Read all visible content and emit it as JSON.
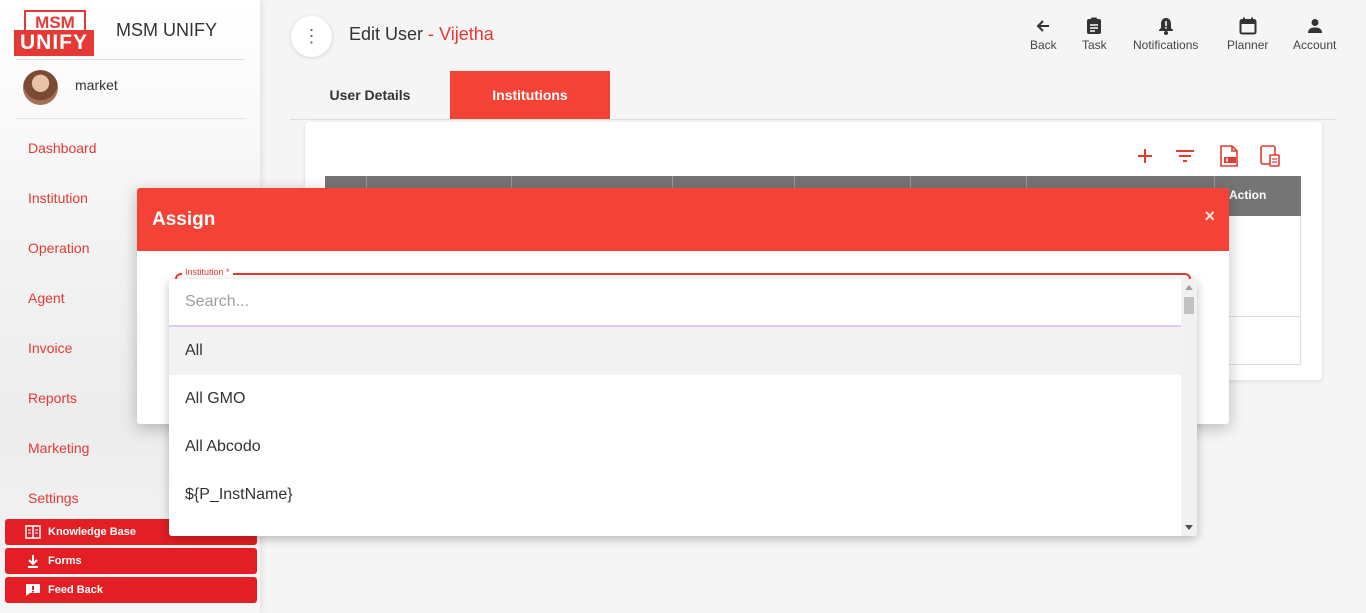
{
  "app": {
    "logo_top": "MSM",
    "logo_bottom": "UNIFY",
    "title": "MSM UNIFY"
  },
  "user": {
    "name": "market"
  },
  "sidebar": {
    "items": [
      {
        "label": "Dashboard"
      },
      {
        "label": "Institution"
      },
      {
        "label": "Operation"
      },
      {
        "label": "Agent"
      },
      {
        "label": "Invoice"
      },
      {
        "label": "Reports"
      },
      {
        "label": "Marketing"
      },
      {
        "label": "Settings"
      }
    ],
    "buttons": [
      {
        "label": "Knowledge Base",
        "icon": "book-icon"
      },
      {
        "label": "Forms",
        "icon": "download-icon"
      },
      {
        "label": "Feed Back",
        "icon": "feedback-icon"
      }
    ]
  },
  "header": {
    "title": "Edit User",
    "separator": " - ",
    "subtitle": "Vijetha",
    "actions": [
      {
        "label": "Back",
        "icon": "arrow-left-icon"
      },
      {
        "label": "Task",
        "icon": "clipboard-icon"
      },
      {
        "label": "Notifications",
        "icon": "bell-icon"
      },
      {
        "label": "Planner",
        "icon": "calendar-icon"
      },
      {
        "label": "Account",
        "icon": "person-icon"
      }
    ]
  },
  "tabs": [
    {
      "label": "User Details",
      "active": false
    },
    {
      "label": "Institutions",
      "active": true
    }
  ],
  "table": {
    "action_header": "Action"
  },
  "modal": {
    "title": "Assign",
    "close": "×",
    "field_label": "Institution *"
  },
  "dropdown": {
    "search_placeholder": "Search...",
    "options": [
      {
        "label": "All",
        "highlighted": true
      },
      {
        "label": "All GMO"
      },
      {
        "label": "All Abcodo"
      },
      {
        "label": "${P_InstName}"
      }
    ]
  },
  "colors": {
    "accent": "#f44336",
    "brand_red": "#e31e24",
    "table_header": "#757575"
  }
}
